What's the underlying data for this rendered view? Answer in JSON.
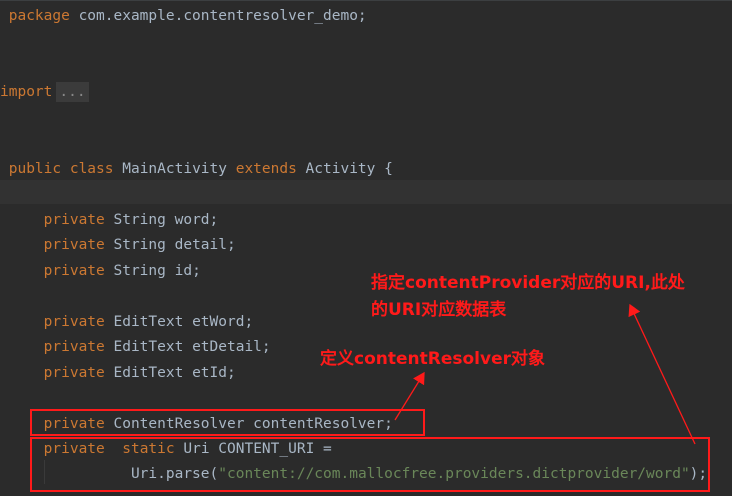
{
  "editor": {
    "l1": {
      "kw": "package",
      "id": " com.example.contentresolver_demo;"
    },
    "l2": {
      "kw": "import",
      "fold": "..."
    },
    "l3": {
      "kw1": "public class",
      "id1": " MainActivity ",
      "kw2": "extends",
      "id2": " Activity {"
    },
    "l4": {
      "kw": "private",
      "id": " String word;"
    },
    "l5": {
      "kw": "private",
      "id": " String detail;"
    },
    "l6": {
      "kw": "private",
      "id": " String id;"
    },
    "l7": {
      "kw": "private",
      "id": " EditText etWord;"
    },
    "l8": {
      "kw": "private",
      "id": " EditText etDetail;"
    },
    "l9": {
      "kw": "private",
      "id": " EditText etId;"
    },
    "l10": {
      "kw": "private",
      "id": " ContentResolver contentResolver;"
    },
    "l11": {
      "kw1": "private",
      "kw2": "static",
      "id": " Uri CONTENT_URI ="
    },
    "l12": {
      "id": "Uri.parse(",
      "str": "\"content://com.mallocfree.providers.dictprovider/word\"",
      "end": ");"
    }
  },
  "annotations": {
    "uri_note_line1": "指定contentProvider对应的URI,此处",
    "uri_note_line2": "的URI对应数据表",
    "resolver_note": "定义contentResolver对象"
  },
  "colors": {
    "background": "#2b2b2b",
    "keyword": "#cc7832",
    "identifier": "#a9b7c6",
    "string": "#6a8759",
    "annotation": "#ff1a1a"
  }
}
